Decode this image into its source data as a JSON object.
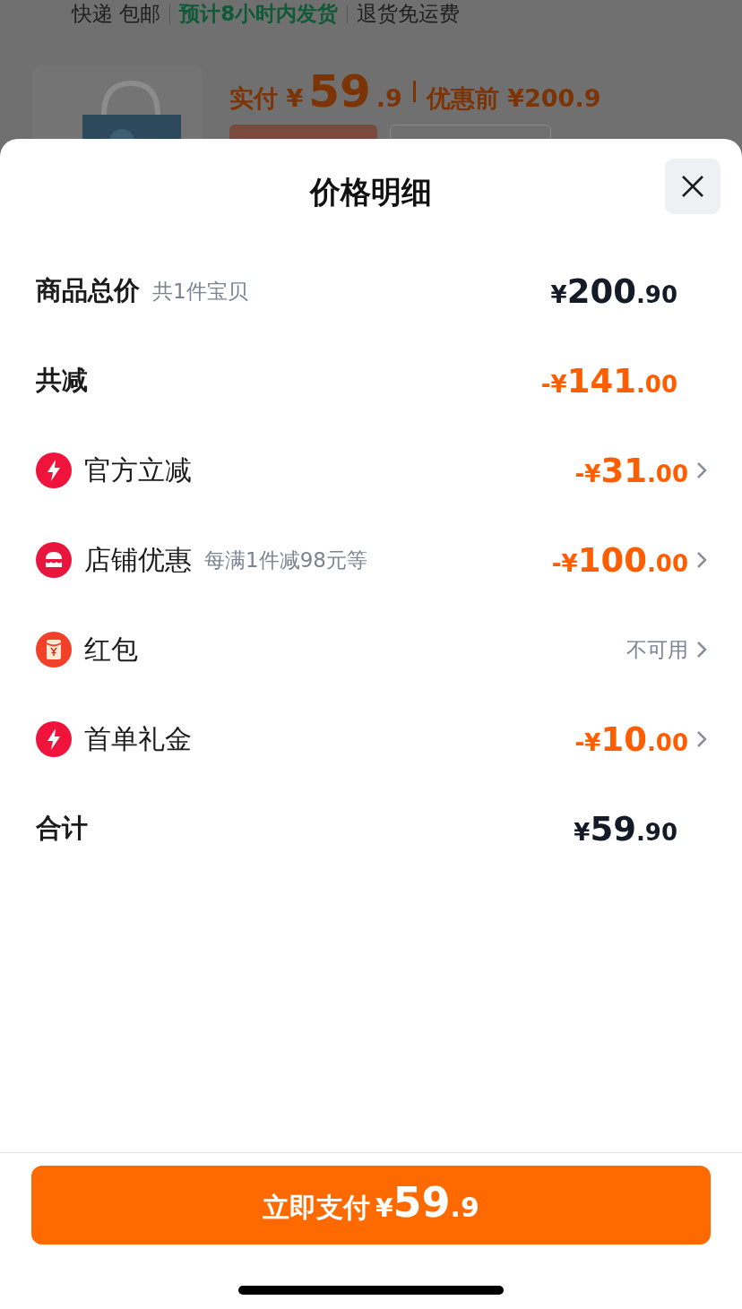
{
  "background_page": {
    "delivery": [
      {
        "text": "快递 包邮",
        "color": "#1d1d1d"
      },
      {
        "text": "预计8小时内发货",
        "color": "#0e5a37"
      },
      {
        "text": "退货免运费",
        "color": "#1d1d1d"
      }
    ],
    "price": {
      "label": "实付",
      "currency": "¥",
      "integer": "59",
      "decimal": ".9",
      "original_label": "优惠前",
      "original": "¥200.9"
    }
  },
  "sheet": {
    "title": "价格明细",
    "rows": [
      {
        "kind": "total",
        "label": "商品总价",
        "note": "共1件宝贝",
        "amount": {
          "prefix": "¥",
          "integer": "200",
          "decimal": ".90",
          "color": "#151b26"
        }
      },
      {
        "kind": "total",
        "label": "共减",
        "amount": {
          "prefix": "-¥",
          "integer": "141",
          "decimal": ".00",
          "color": "#ff5e00"
        }
      },
      {
        "kind": "bolt",
        "label": "官方立减",
        "amount": {
          "prefix": "-¥",
          "integer": "31",
          "decimal": ".00",
          "color": "#ff5e00"
        }
      },
      {
        "kind": "store",
        "label": "店铺优惠",
        "note": "每满1件减98元等",
        "amount": {
          "prefix": "-¥",
          "integer": "100",
          "decimal": ".00",
          "color": "#ff5e00"
        }
      },
      {
        "kind": "envelope",
        "label": "红包",
        "status": "不可用"
      },
      {
        "kind": "bolt",
        "label": "首单礼金",
        "amount": {
          "prefix": "-¥",
          "integer": "10",
          "decimal": ".00",
          "color": "#ff5e00"
        }
      },
      {
        "kind": "total",
        "label": "合计",
        "amount": {
          "prefix": "¥",
          "integer": "59",
          "decimal": ".90",
          "color": "#151b26"
        }
      }
    ],
    "pay_button": {
      "label": "立即支付",
      "currency": "¥",
      "integer": "59",
      "decimal": ".9"
    }
  }
}
